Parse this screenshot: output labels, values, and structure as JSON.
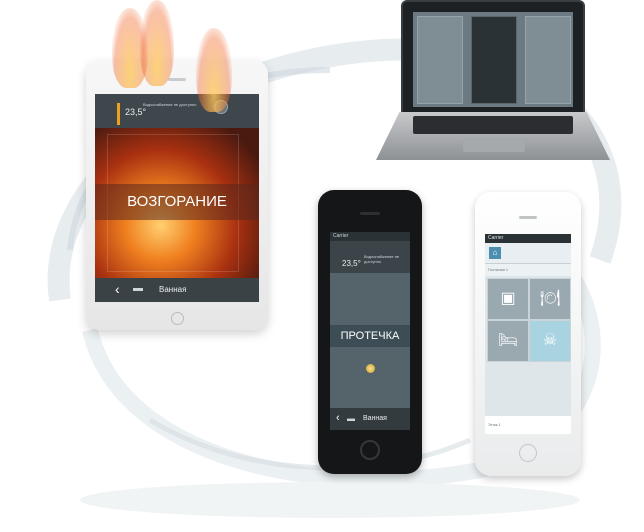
{
  "colors": {
    "fire_orange": "#f08020",
    "temp_accent": "#f0a020",
    "tile_gray": "#9aa8b0",
    "tile_alert": "#a9d3e0"
  },
  "tablet": {
    "temperature": "23,5°",
    "topbar_note": "Водоснабжение не доступно",
    "alarm_text": "ВОЗГОРАНИЕ",
    "room_label": "Ванная",
    "back_icon": "chevron-left-icon",
    "room_icon": "bathtub-icon"
  },
  "phone_black": {
    "status_carrier": "Carrier",
    "temperature": "23,5°",
    "topbar_note": "Водоснабжение не доступно",
    "alarm_text": "ПРОТЕЧКА",
    "room_label": "Ванная"
  },
  "phone_white": {
    "status_carrier": "Carrier",
    "subheader": "Гостиная 1",
    "footer": "Этаж 1",
    "tiles": [
      {
        "icon": "media-center-icon",
        "glyph": "▣"
      },
      {
        "icon": "dining-icon",
        "glyph": "🍽"
      },
      {
        "icon": "bed-icon",
        "glyph": "🛏"
      },
      {
        "icon": "alert-icon",
        "glyph": "☠"
      }
    ]
  }
}
